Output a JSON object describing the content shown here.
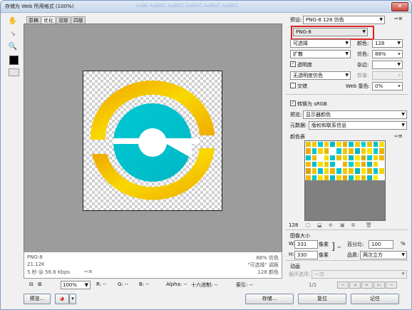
{
  "window": {
    "title": "存储为 Web 所用格式 (100%)",
    "title_decoration": "AaBt  AaBbC  AaBbC  AaBbC  AaBbC  AaBbC",
    "close_glyph": "✕"
  },
  "tabs": [
    "原稿",
    "优化",
    "双联",
    "四联"
  ],
  "tools": [
    {
      "name": "hand-tool-icon",
      "glyph": "✋"
    },
    {
      "name": "slice-select-icon",
      "glyph": "↘"
    },
    {
      "name": "zoom-icon",
      "glyph": "🔍"
    },
    {
      "name": "eyedropper-icon",
      "glyph": "✎"
    }
  ],
  "info": {
    "format": "PNG-8",
    "size": "21.12K",
    "time": "5 秒 @ 56.6 Kbps",
    "time_suffix": "⇨≡",
    "dither": "88% 仿色",
    "palette": "\"可选择\" 调板",
    "colors": "128 颜色"
  },
  "status": {
    "zoom": "100%",
    "r": "R: --",
    "g": "G: --",
    "b": "B: --",
    "alpha": "Alpha: --",
    "hex": "十六进制: --",
    "index": "索引: --"
  },
  "preview_label": "预览...",
  "settings": {
    "preset_label": "预设:",
    "preset_value": "PNG-8 128 仿色",
    "format_value": "PNG-8",
    "reduction_value": "可选择",
    "colors_label": "颜色:",
    "colors_value": "128",
    "dither_algo": "扩散",
    "dither_label": "仿色:",
    "dither_value": "88%",
    "transparency_label": "透明度",
    "transparency_checked": true,
    "matte_label": "杂边:",
    "no_transparency_dither": "无透明度仿色",
    "amount_label": "数量:",
    "interlaced_label": "交错",
    "interlaced_checked": false,
    "web_snap_label": "Web 靠色:",
    "web_snap_value": "0%",
    "convert_srgb_label": "转换为 sRGB",
    "convert_srgb_checked": true,
    "preview_label": "预览:",
    "preview_value": "显示器颜色",
    "metadata_label": "元数据:",
    "metadata_value": "版权和联系信息"
  },
  "color_table": {
    "title": "颜色表",
    "count": "128",
    "colors": [
      "#e8c400",
      "#f0c800",
      "#00c8d0",
      "#f4d000",
      "#00b8c8",
      "#f8d800",
      "#e0b000",
      "#00c0cc",
      "#f4cc00",
      "#00d0d8",
      "#ecc000",
      "#00bcc8",
      "#f8e000",
      "#f0a800",
      "#00c4cc",
      "#f8d400",
      "#e4b800",
      "#ffffff",
      "#00c8d4",
      "#f4c400",
      "#e8bc00",
      "#00b4c4",
      "#f0d000",
      "#fce400",
      "#00ccd4",
      "#e8b400",
      "#00c0c8",
      "#f0bc00",
      "#ffffff",
      "#f8dc00",
      "#00c4d0",
      "#e4c000",
      "#f4d400",
      "#00b8c4",
      "#fce800",
      "#e0a800",
      "#00c8d0",
      "#f8d000",
      "#ecb800",
      "#f8c000",
      "#00bcc8",
      "#fce000",
      "#e8c800",
      "#00c4cc",
      "#ffffff",
      "#f0b000",
      "#00ccd4",
      "#f4e000",
      "#e4b000",
      "#00b8c8",
      "#f8d800",
      "#ffffff",
      "#e0a000",
      "#f0c400",
      "#00c0cc",
      "#fcd800",
      "#e8b800",
      "#00c8d0",
      "#f4cc00",
      "#ecc400",
      "#00b4c4",
      "#f8e400",
      "#e0b400",
      "#00c4cc",
      "#f0d400",
      "#f4b800",
      "#00c8d0",
      "#fce400",
      "#e8c000",
      "#00bcc8",
      "#f8d000",
      "#eca800",
      "#00c4cc",
      "#f4dc00",
      "#e4bc00",
      "#00b8c4",
      "#fcec00",
      "#ffffff"
    ],
    "tools": [
      "▢",
      "⬓",
      "⊕",
      "▣",
      "⧉",
      "🗑"
    ]
  },
  "image_size": {
    "title": "图像大小",
    "w_label": "W:",
    "w_value": "331",
    "h_label": "H:",
    "h_value": "330",
    "unit": "像素",
    "percent_label": "百分比:",
    "percent_value": "100",
    "percent_unit": "%",
    "quality_label": "品质:",
    "quality_value": "两次立方"
  },
  "animation": {
    "title": "动画",
    "loop_label": "循环选项:",
    "loop_value": "一次",
    "frame": "1/1"
  },
  "buttons": {
    "save": "存储...",
    "reset": "复位",
    "remember": "记住"
  },
  "colors": {
    "accent_red": "#e02020",
    "logo_cyan": "#00c8d4",
    "logo_yellow": "#f8d800",
    "logo_orange": "#f0a000"
  }
}
